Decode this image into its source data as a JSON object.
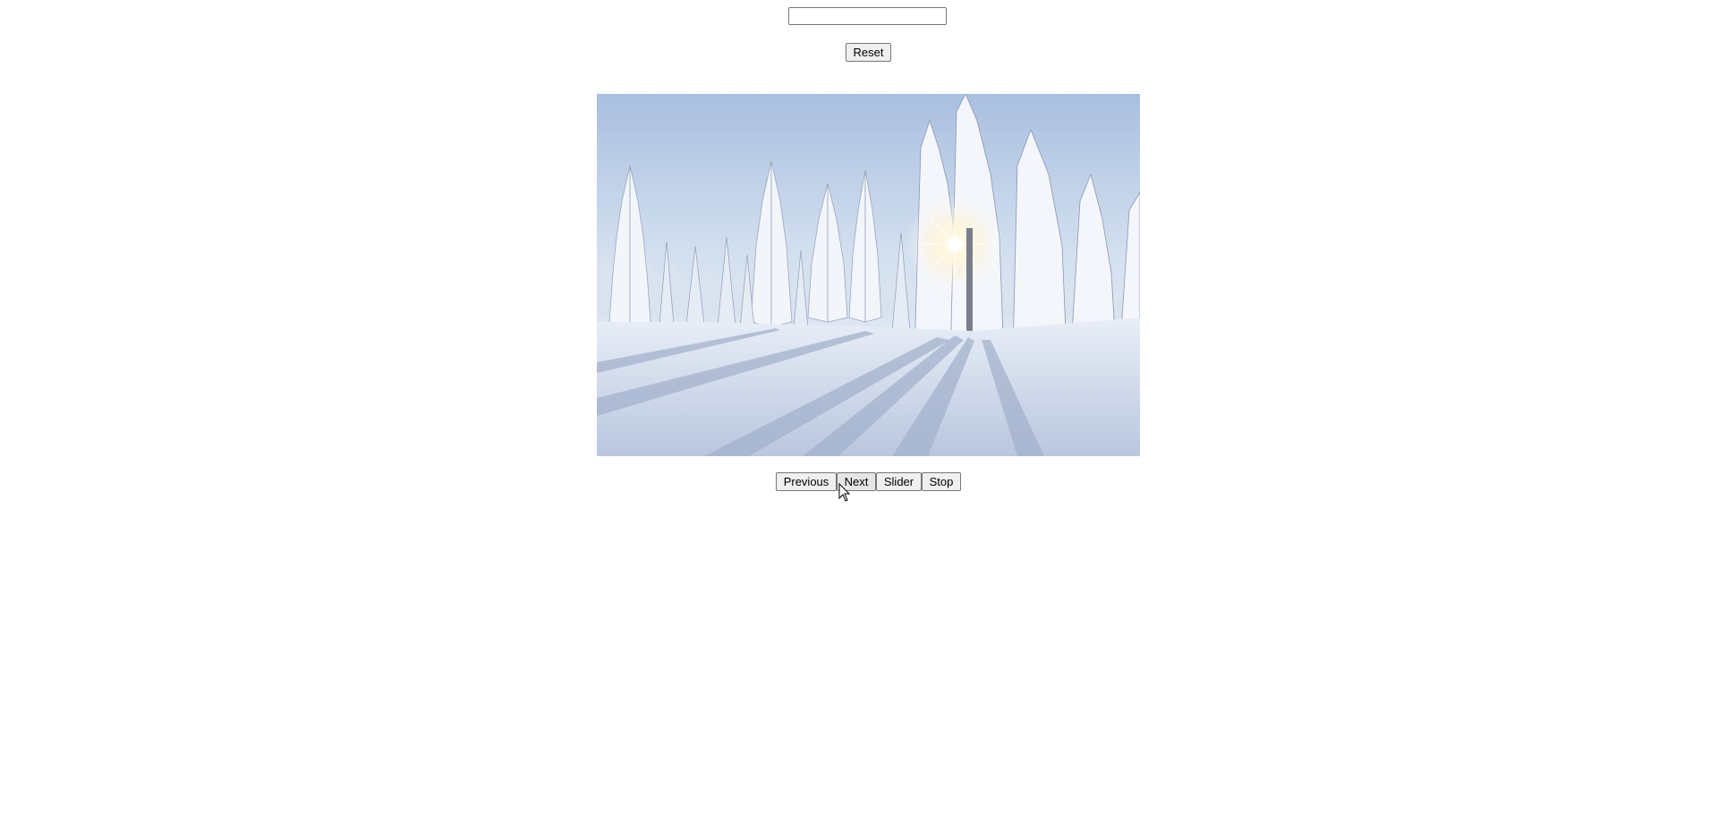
{
  "search": {
    "value": "",
    "placeholder": ""
  },
  "controls": {
    "reset_label": "Reset"
  },
  "slideshow": {
    "image_description": "snow-covered-forest-with-sun",
    "buttons": {
      "previous_label": "Previous",
      "next_label": "Next",
      "slider_label": "Slider",
      "stop_label": "Stop"
    }
  },
  "colors": {
    "button_bg": "#efefef",
    "button_border": "#767676",
    "page_bg": "#ffffff"
  }
}
